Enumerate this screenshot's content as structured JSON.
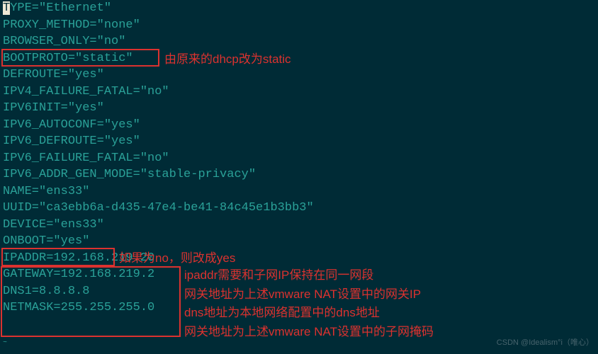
{
  "config": {
    "lines": [
      "TYPE=\"Ethernet\"",
      "PROXY_METHOD=\"none\"",
      "BROWSER_ONLY=\"no\"",
      "BOOTPROTO=\"static\"",
      "DEFROUTE=\"yes\"",
      "IPV4_FAILURE_FATAL=\"no\"",
      "IPV6INIT=\"yes\"",
      "IPV6_AUTOCONF=\"yes\"",
      "IPV6_DEFROUTE=\"yes\"",
      "IPV6_FAILURE_FATAL=\"no\"",
      "IPV6_ADDR_GEN_MODE=\"stable-privacy\"",
      "NAME=\"ens33\"",
      "UUID=\"ca3ebb6a-d435-47e4-be41-84c45e1b3bb3\"",
      "DEVICE=\"ens33\"",
      "ONBOOT=\"yes\"",
      "IPADDR=192.168.219.20",
      "GATEWAY=192.168.219.2",
      "DNS1=8.8.8.8",
      "NETMASK=255.255.255.0"
    ]
  },
  "annotations": {
    "a1": "由原来的dhcp改为static",
    "a2": "如果为no，则改成yes",
    "a3": "ipaddr需要和子网IP保持在同一网段",
    "a4": "网关地址为上述vmware NAT设置中的网关IP",
    "a5": "dns地址为本地网络配置中的dns地址",
    "a6": "网关地址为上述vmware NAT设置中的子网掩码"
  },
  "watermark": "CSDN @Idealism°i（唯心）",
  "tilde": "~"
}
